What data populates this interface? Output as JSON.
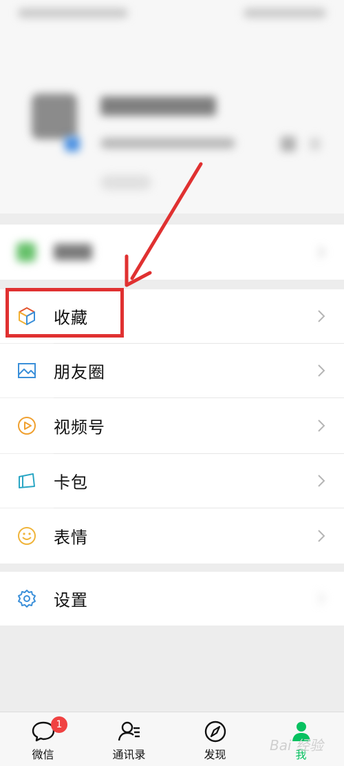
{
  "menu": {
    "favorites": "收藏",
    "moments": "朋友圈",
    "channels": "视频号",
    "cards": "卡包",
    "stickers": "表情",
    "settings": "设置"
  },
  "tabbar": {
    "chats": "微信",
    "chats_badge": "1",
    "contacts": "通讯录",
    "discover": "发现",
    "me": "我"
  },
  "watermark": "Bai 经验",
  "colors": {
    "annotation": "#e03131",
    "active_tab": "#07c160",
    "badge": "#f04242"
  }
}
